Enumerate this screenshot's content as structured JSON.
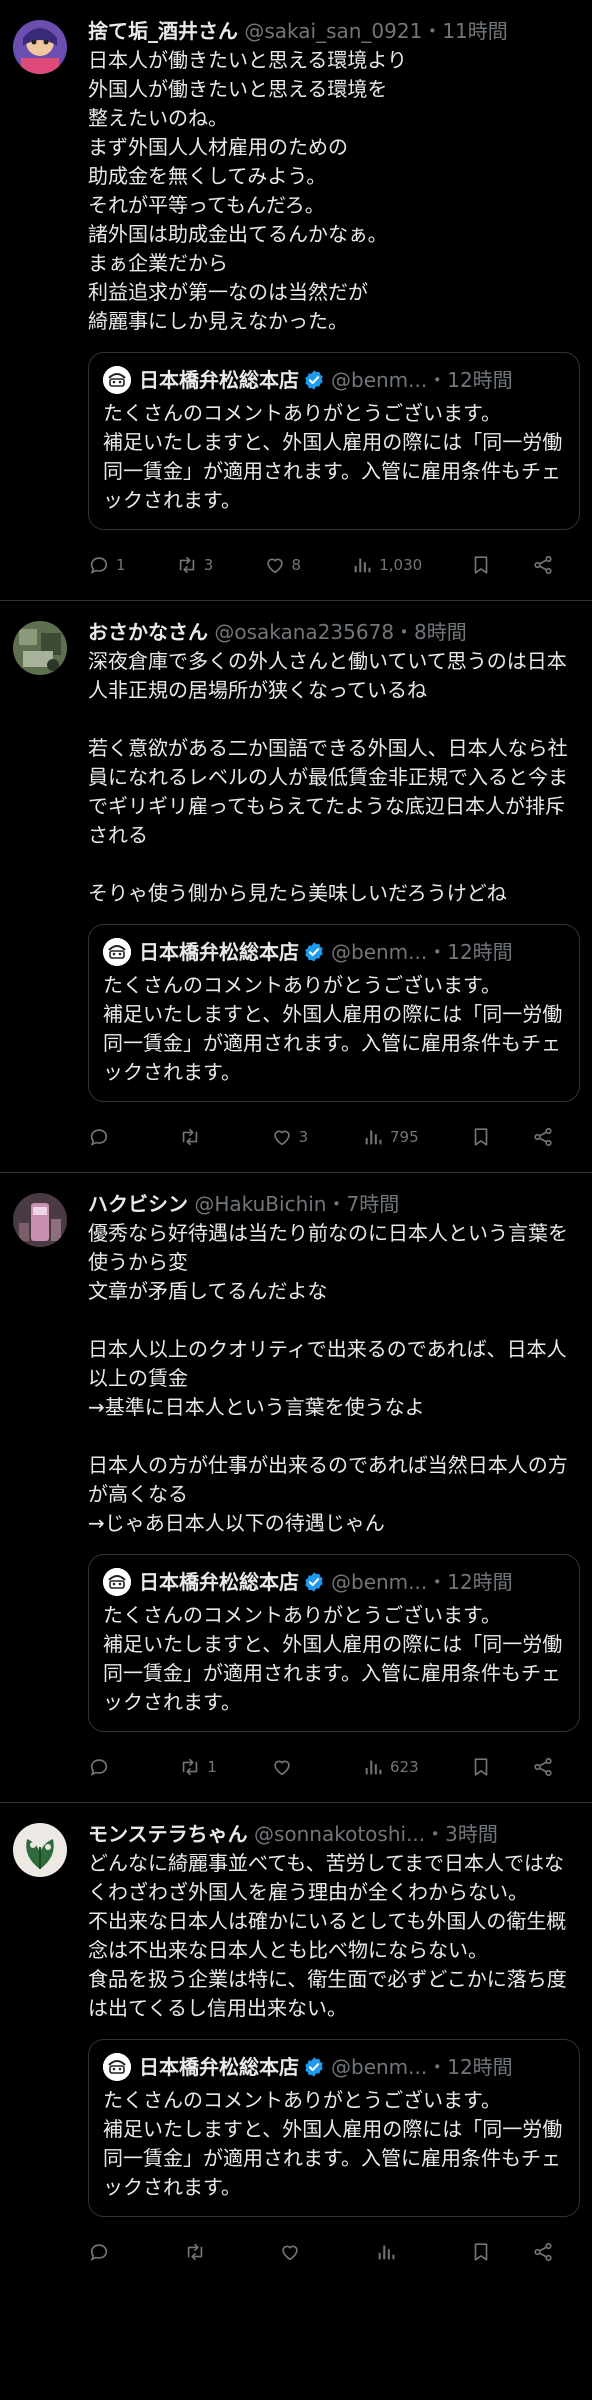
{
  "quote": {
    "name": "日本橋弁松総本店",
    "body": "たくさんのコメントありがとうございます。\n補足いたしますと、外国人雇用の際には「同一労働同一賃金」が適用されます。入管に雇用条件もチェックされます。",
    "verified_color": "#1d9bf0"
  },
  "colors": {
    "background": "#000000",
    "text": "#e7e9ea",
    "secondary": "#71767b",
    "border": "#2f3336"
  },
  "icons": [
    "reply-icon",
    "retweet-icon",
    "like-icon",
    "views-icon",
    "bookmark-icon",
    "share-icon",
    "verified-badge-icon"
  ],
  "tweets": [
    {
      "name": "捨て垢_酒井さん",
      "handle": "@sakai_san_0921",
      "time": "・11時間",
      "body": "日本人が働きたいと思える環境より\n外国人が働きたいと思える環境を\n整えたいのね。\nまず外国人人材雇用のための\n助成金を無くしてみよう。\nそれが平等ってもんだろ。\n諸外国は助成金出てるんかなぁ。\nまぁ企業だから\n利益追求が第一なのは当然だが\n綺麗事にしか見えなかった。",
      "quote_handle": "@benm...",
      "quote_time": "・12時間",
      "replies": "1",
      "retweets": "3",
      "likes": "8",
      "views": "1,030"
    },
    {
      "name": "おさかなさん",
      "handle": "@osakana235678",
      "time": "・8時間",
      "body": "深夜倉庫で多くの外人さんと働いていて思うのは日本人非正規の居場所が狭くなっているね\n\n若く意欲がある二か国語できる外国人、日本人なら社員になれるレベルの人が最低賃金非正規で入ると今までギリギリ雇ってもらえてたような底辺日本人が排斥される\n\nそりゃ使う側から見たら美味しいだろうけどね",
      "quote_handle": "@benm...",
      "quote_time": "・12時間",
      "replies": "",
      "retweets": "",
      "likes": "3",
      "views": "795"
    },
    {
      "name": "ハクビシン",
      "handle": "@HakuBichin",
      "time": "・7時間",
      "body": "優秀なら好待遇は当たり前なのに日本人という言葉を使うから変\n文章が矛盾してるんだよな\n\n日本人以上のクオリティで出来るのであれば、日本人以上の賃金\n→基準に日本人という言葉を使うなよ\n\n日本人の方が仕事が出来るのであれば当然日本人の方が高くなる\n→じゃあ日本人以下の待遇じゃん",
      "quote_handle": "@benm...",
      "quote_time": "・12時間",
      "replies": "",
      "retweets": "1",
      "likes": "",
      "views": "623"
    },
    {
      "name": "モンステラちゃん",
      "handle": "@sonnakotoshi...",
      "time": "・3時間",
      "body": "どんなに綺麗事並べても、苦労してまで日本人ではなくわざわざ外国人を雇う理由が全くわからない。\n不出来な日本人は確かにいるとしても外国人の衛生概念は不出来な日本人とも比べ物にならない。\n食品を扱う企業は特に、衛生面で必ずどこかに落ち度は出てくるし信用出来ない。",
      "quote_handle": "@benm...",
      "quote_time": "・12時間",
      "replies": "",
      "retweets": "",
      "likes": "",
      "views": ""
    }
  ]
}
